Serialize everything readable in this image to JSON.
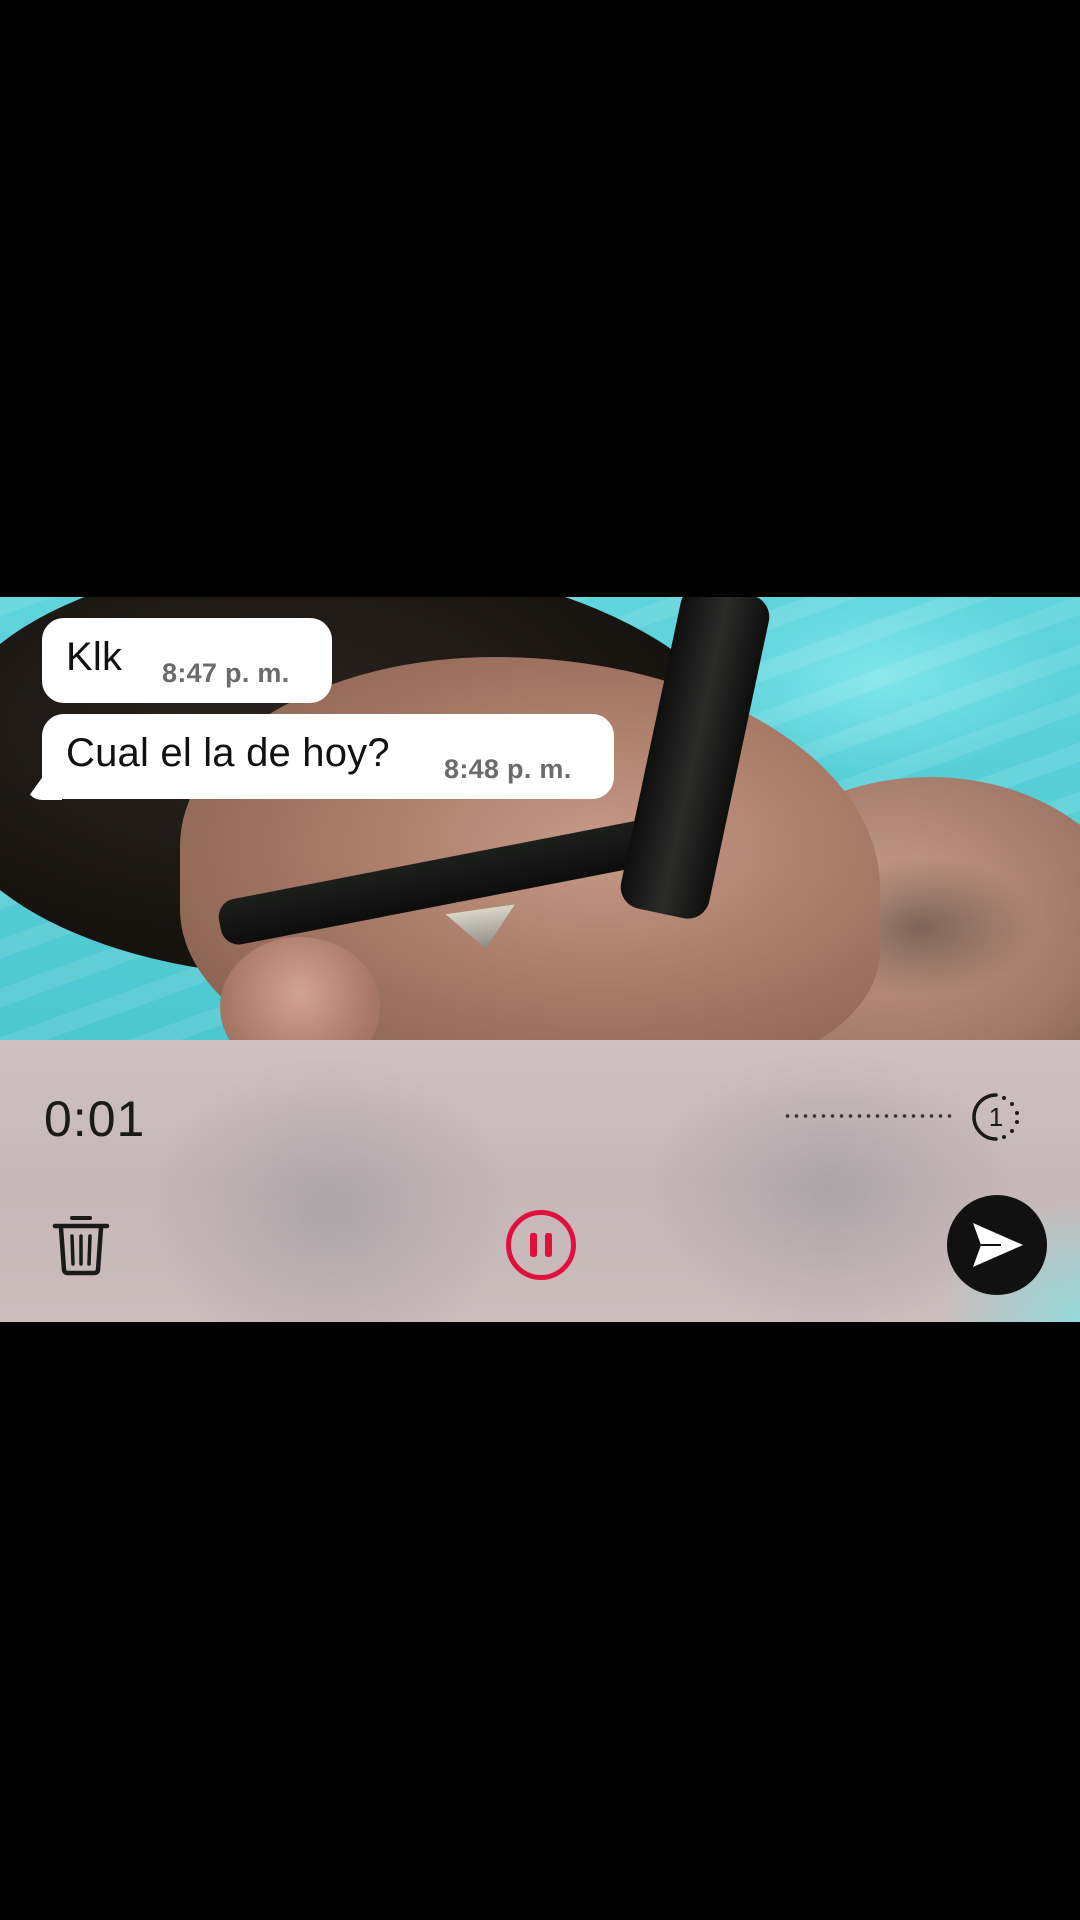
{
  "messages": [
    {
      "text": "Klk",
      "time": "8:47 p. m."
    },
    {
      "text": "Cual el la de hoy?",
      "time": "8:48 p. m."
    }
  ],
  "recorder": {
    "elapsed": "0:01",
    "speed_label": "1"
  },
  "icons": {
    "trash": "trash-icon",
    "pause": "pause-icon",
    "send": "send-icon",
    "speed": "playback-speed-icon"
  },
  "colors": {
    "pause_accent": "#e0103d",
    "send_button": "#111111",
    "bubble": "#ffffff"
  }
}
